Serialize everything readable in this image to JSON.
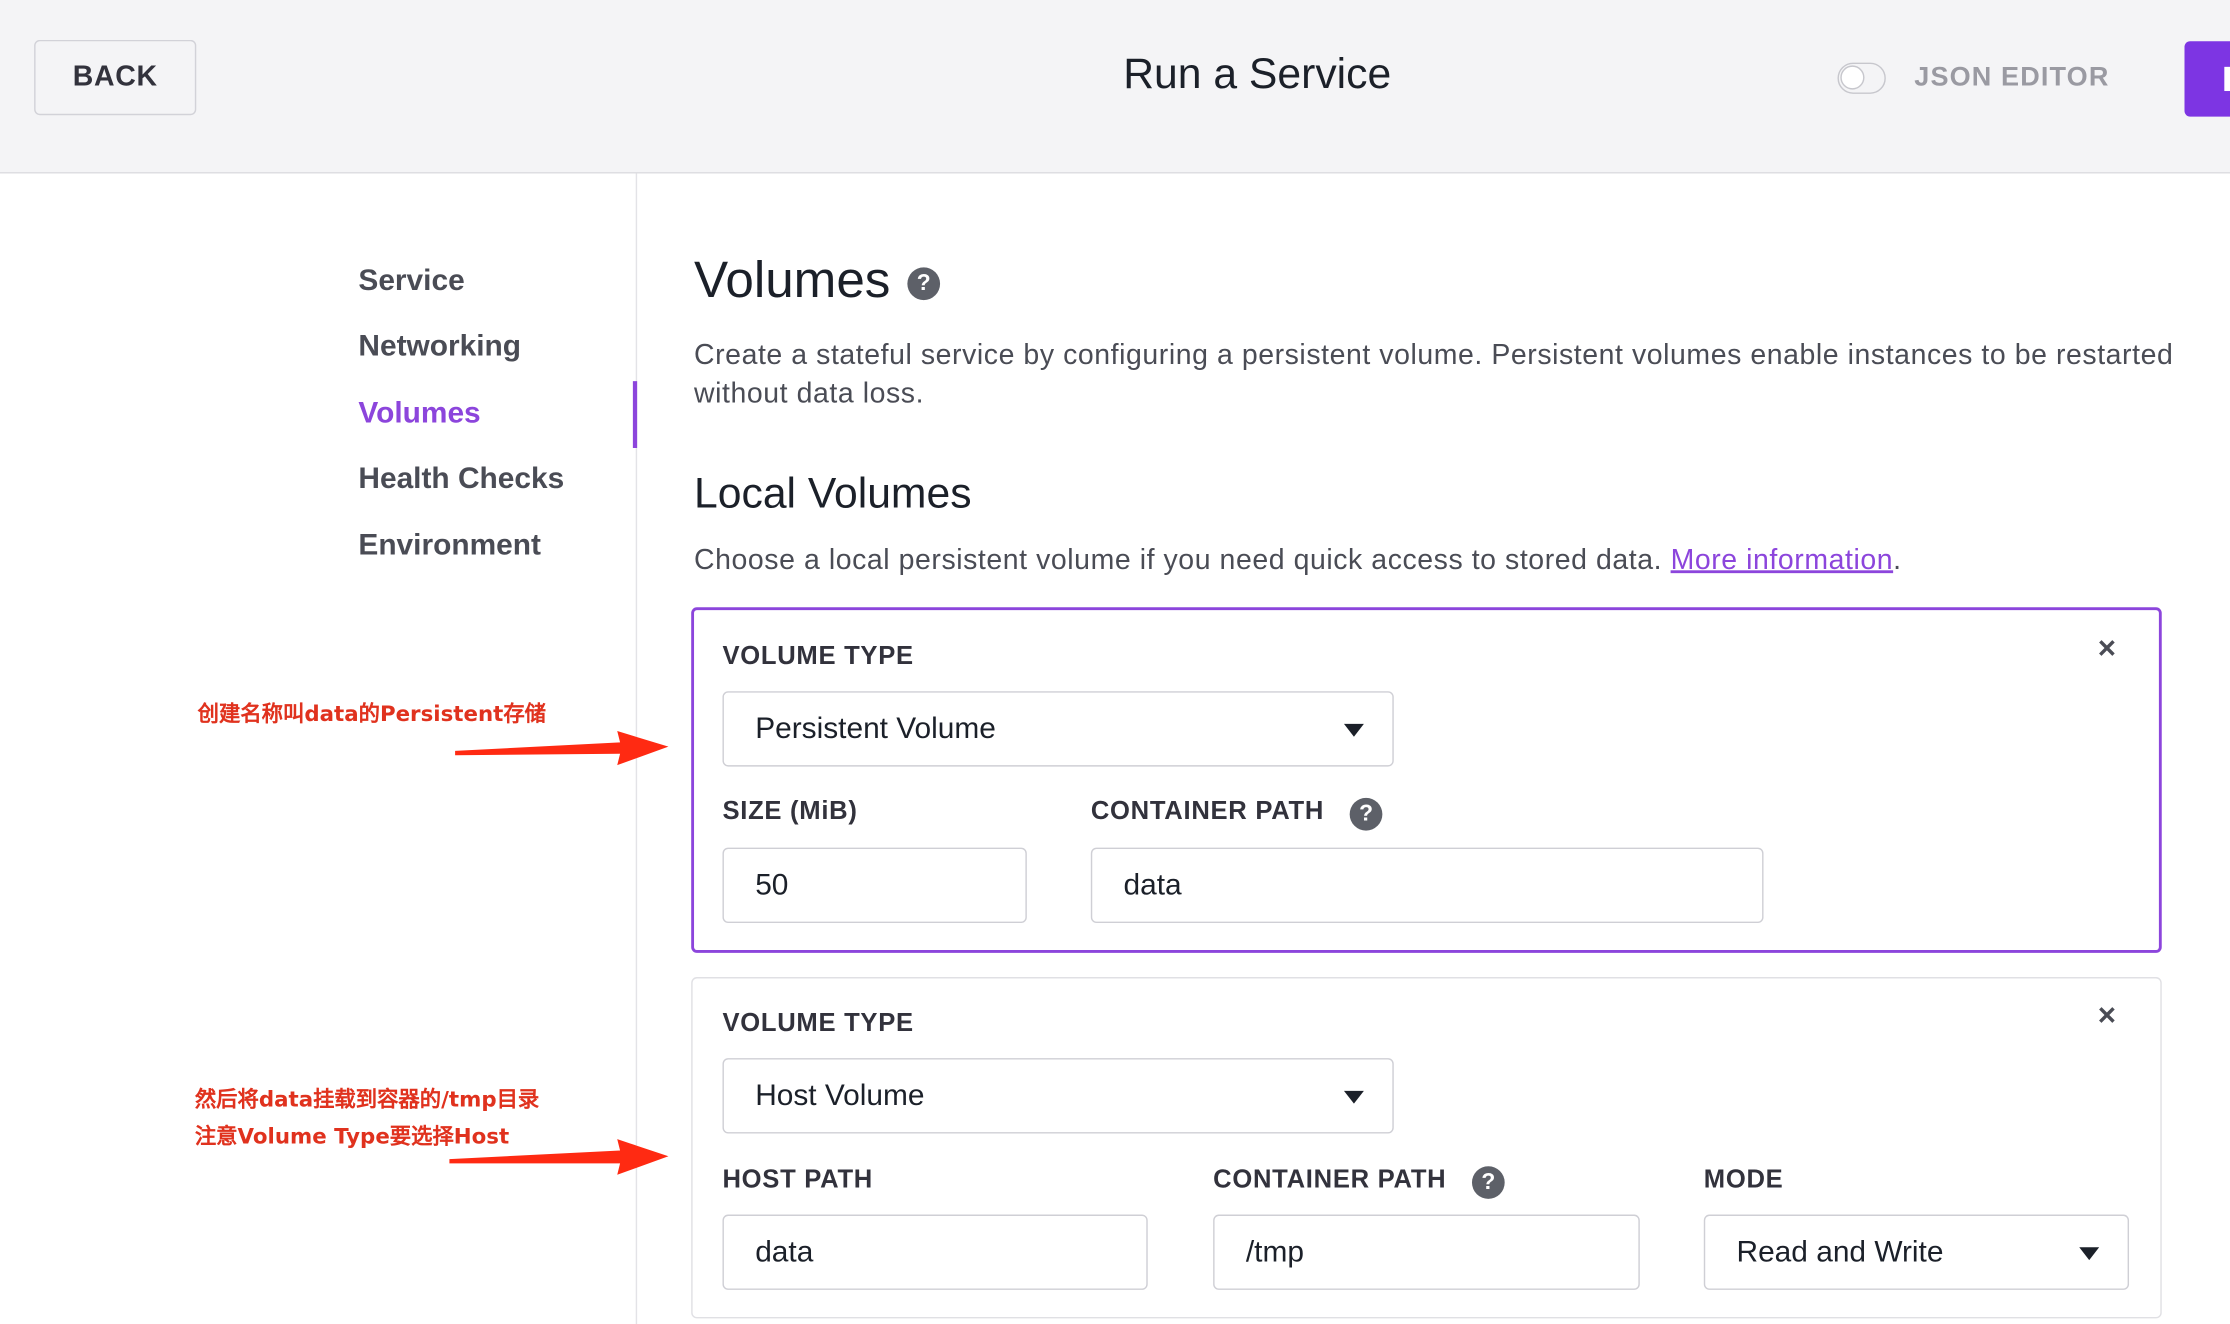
{
  "header": {
    "back_label": "BACK",
    "title": "Run a Service",
    "json_editor_label": "JSON EDITOR",
    "json_editor_on": false
  },
  "sidebar": {
    "items": [
      {
        "label": "Service",
        "active": false
      },
      {
        "label": "Networking",
        "active": false
      },
      {
        "label": "Volumes",
        "active": true
      },
      {
        "label": "Health Checks",
        "active": false
      },
      {
        "label": "Environment",
        "active": false
      }
    ]
  },
  "main": {
    "title": "Volumes",
    "help_glyph": "?",
    "description": "Create a stateful service by configuring a persistent volume. Persistent volumes enable instances to be restarted without data loss.",
    "local_volumes": {
      "title": "Local Volumes",
      "description": "Choose a local persistent volume if you need quick access to stored data.",
      "link_text": "More information",
      "link_suffix": "."
    },
    "volumes": [
      {
        "type_label": "VOLUME TYPE",
        "type_value": "Persistent Volume",
        "size_label": "SIZE (MiB)",
        "size_value": "50",
        "container_path_label": "CONTAINER PATH",
        "container_path_value": "data"
      },
      {
        "type_label": "VOLUME TYPE",
        "type_value": "Host Volume",
        "host_path_label": "HOST PATH",
        "host_path_value": "data",
        "container_path_label": "CONTAINER PATH",
        "container_path_value": "/tmp",
        "mode_label": "MODE",
        "mode_value": "Read and Write"
      }
    ],
    "close_glyph": "×"
  },
  "annotations": {
    "note1": "创建名称叫data的Persistent存储",
    "note2_line1": "然后将data挂载到容器的/tmp目录",
    "note2_line2": "注意Volume Type要选择Host",
    "color": "#e0321e"
  },
  "colors": {
    "accent": "#8c45dc",
    "primary_button": "#7d35e3",
    "header_bg": "#f4f4f6"
  }
}
